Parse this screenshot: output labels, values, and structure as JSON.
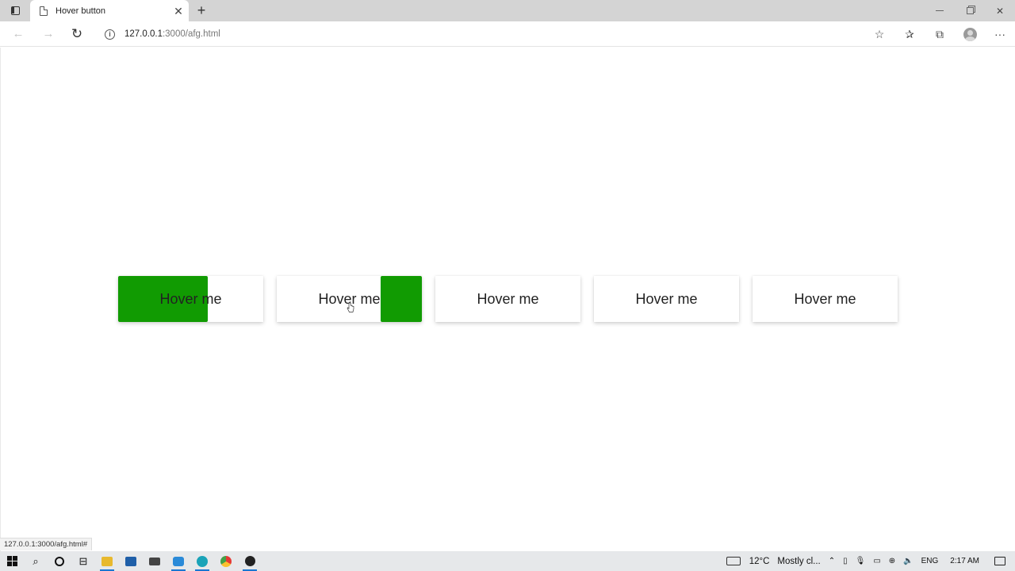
{
  "browser": {
    "tab_title": "Hover button",
    "tab_close": "✕",
    "new_tab": "+",
    "address_host": "127.0.0.1",
    "address_rest": ":3000/afg.html",
    "status_url": "127.0.0.1:3000/afg.html#"
  },
  "page": {
    "buttons": [
      {
        "label": "Hover me",
        "hover_fill_fraction": 0.62,
        "fill_side": "left"
      },
      {
        "label": "Hover me",
        "hover_fill_fraction": 0.28,
        "fill_side": "right"
      },
      {
        "label": "Hover me",
        "hover_fill_fraction": 0
      },
      {
        "label": "Hover me",
        "hover_fill_fraction": 0
      },
      {
        "label": "Hover me",
        "hover_fill_fraction": 0
      }
    ],
    "accent_color": "#119b02"
  },
  "taskbar": {
    "temperature": "12°C",
    "weather_text": "Mostly cl...",
    "language": "ENG",
    "time": "2:17 AM"
  }
}
